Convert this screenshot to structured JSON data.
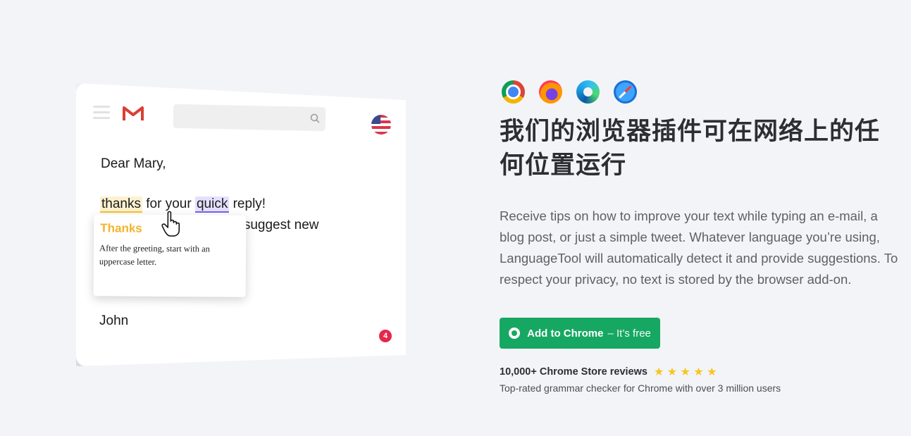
{
  "mock": {
    "greeting": "Dear Mary,",
    "word_thanks": "thanks",
    "text_for_your": " for your ",
    "word_quick": "quick",
    "text_reply": " reply!",
    "line2_visible": "o suggest new",
    "signature": "John",
    "notification_count": "4",
    "popup": {
      "title": "Thanks",
      "message": "After the greeting, start with an uppercase letter."
    },
    "colors": {
      "spelling_highlight": "#f2c531",
      "style_highlight": "#7d5cf0",
      "badge": "#e5274c"
    }
  },
  "browsers": [
    {
      "icon": "chrome-icon"
    },
    {
      "icon": "firefox-icon"
    },
    {
      "icon": "edge-icon"
    },
    {
      "icon": "safari-icon"
    }
  ],
  "headline": "我们的浏览器插件可在网络上的任何位置运行",
  "description": "Receive tips on how to improve your text while typing an e-mail, a blog post, or just a simple tweet. Whatever language you’re using, LanguageTool will automatically detect it and provide suggestions. To respect your privacy, no text is stored by the browser add-on.",
  "cta": {
    "label": "Add to Chrome",
    "suffix": "– It’s free",
    "color": "#16a862"
  },
  "reviews": {
    "title": "10,000+ Chrome Store reviews",
    "rating": 5,
    "stars": "★ ★ ★ ★ ★"
  },
  "subtext": "Top-rated grammar checker for Chrome with over 3 million users"
}
